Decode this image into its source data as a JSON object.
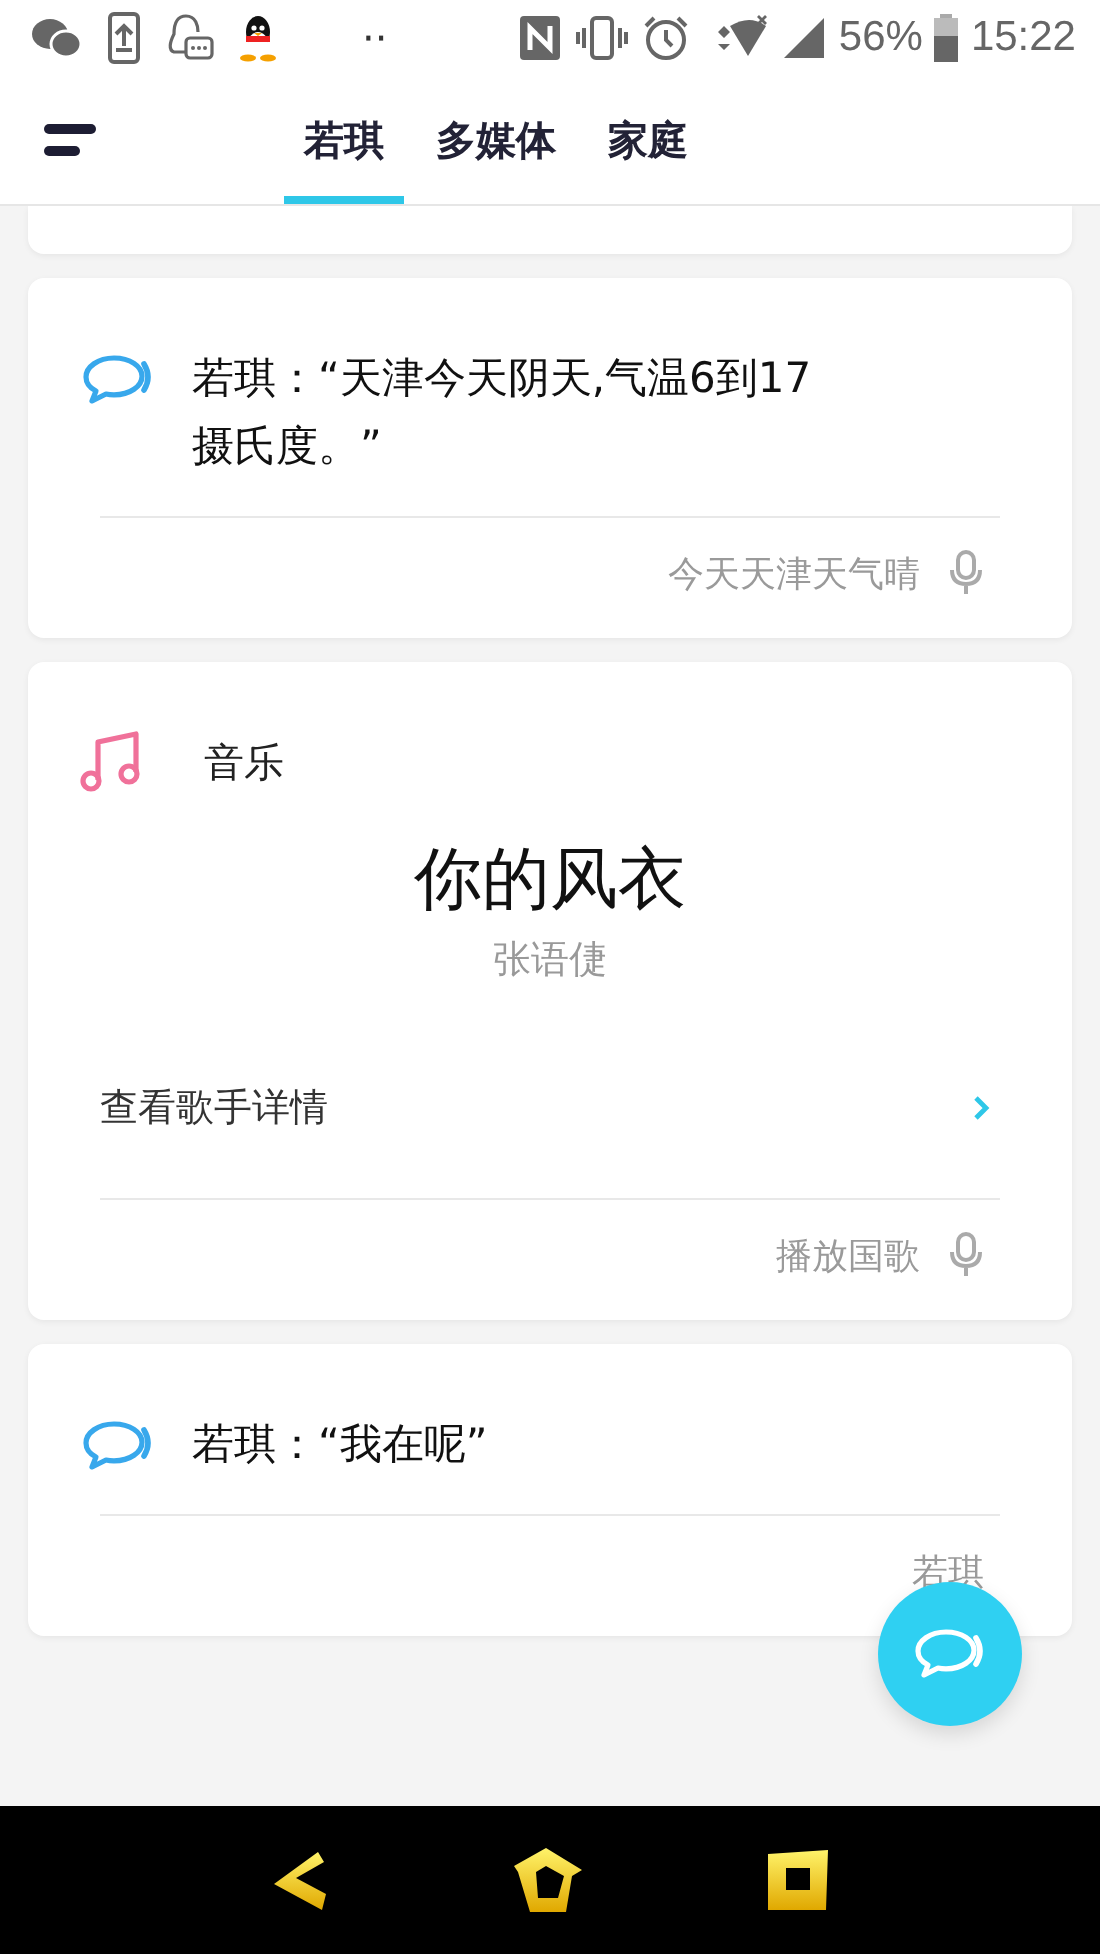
{
  "status_bar": {
    "overflow": "··",
    "battery": "56%",
    "time": "15:22"
  },
  "tabs": [
    {
      "label": "若琪",
      "selected": true
    },
    {
      "label": "多媒体",
      "selected": false
    },
    {
      "label": "家庭",
      "selected": false
    }
  ],
  "cards": [
    {
      "kind": "partial"
    },
    {
      "kind": "reply",
      "text": "若琪：“天津今天阴天,气温6到17摄氏度。”",
      "hint": "今天天津天气晴"
    },
    {
      "kind": "music",
      "category": "音乐",
      "song": "你的风衣",
      "artist": "张语倢",
      "link": "查看歌手详情",
      "hint": "播放国歌"
    },
    {
      "kind": "reply",
      "text": "若琪：“我在呢”",
      "hint": "若琪"
    }
  ]
}
